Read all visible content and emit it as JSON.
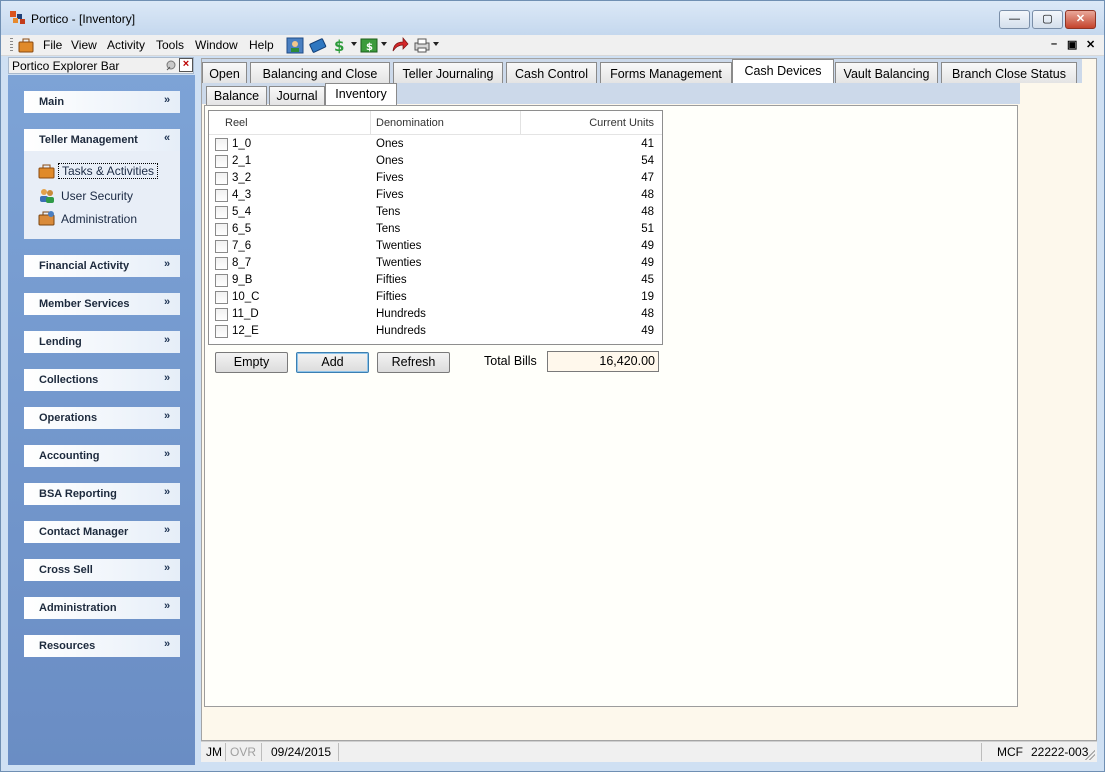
{
  "window": {
    "title": "Portico - [Inventory]"
  },
  "menu": {
    "items": [
      "File",
      "View",
      "Activity",
      "Tools",
      "Window",
      "Help"
    ],
    "mdi_min": "–",
    "mdi_restore": "▣",
    "mdi_close": "✕"
  },
  "explorer": {
    "title": "Portico Explorer Bar",
    "groups": [
      {
        "label": "Main",
        "chevron": "»"
      },
      {
        "label": "Teller Management",
        "chevron": "«",
        "tasks": [
          "Tasks & Activities",
          "User Security",
          "Administration"
        ]
      },
      {
        "label": "Financial Activity",
        "chevron": "»"
      },
      {
        "label": "Member Services",
        "chevron": "»"
      },
      {
        "label": "Lending",
        "chevron": "»"
      },
      {
        "label": "Collections",
        "chevron": "»"
      },
      {
        "label": "Operations",
        "chevron": "»"
      },
      {
        "label": "Accounting",
        "chevron": "»"
      },
      {
        "label": "BSA Reporting",
        "chevron": "»"
      },
      {
        "label": "Contact Manager",
        "chevron": "»"
      },
      {
        "label": "Cross Sell",
        "chevron": "»"
      },
      {
        "label": "Administration",
        "chevron": "»"
      },
      {
        "label": "Resources",
        "chevron": "»"
      }
    ]
  },
  "tabs": {
    "main": [
      "Open",
      "Balancing and Close",
      "Teller Journaling",
      "Cash Control",
      "Forms Management",
      "Cash Devices",
      "Vault Balancing",
      "Branch Close Status"
    ],
    "main_active": "Cash Devices",
    "sub": [
      "Balance",
      "Journal",
      "Inventory"
    ],
    "sub_active": "Inventory"
  },
  "grid": {
    "columns": [
      "Reel",
      "Denomination",
      "Current Units"
    ],
    "rows": [
      {
        "reel": "1_0",
        "denomination": "Ones",
        "units": "41",
        "checked": false
      },
      {
        "reel": "2_1",
        "denomination": "Ones",
        "units": "54",
        "checked": false
      },
      {
        "reel": "3_2",
        "denomination": "Fives",
        "units": "47",
        "checked": false
      },
      {
        "reel": "4_3",
        "denomination": "Fives",
        "units": "48",
        "checked": false
      },
      {
        "reel": "5_4",
        "denomination": "Tens",
        "units": "48",
        "checked": false
      },
      {
        "reel": "6_5",
        "denomination": "Tens",
        "units": "51",
        "checked": false
      },
      {
        "reel": "7_6",
        "denomination": "Twenties",
        "units": "49",
        "checked": false
      },
      {
        "reel": "8_7",
        "denomination": "Twenties",
        "units": "49",
        "checked": false
      },
      {
        "reel": "9_B",
        "denomination": "Fifties",
        "units": "45",
        "checked": false
      },
      {
        "reel": "10_C",
        "denomination": "Fifties",
        "units": "19",
        "checked": false
      },
      {
        "reel": "11_D",
        "denomination": "Hundreds",
        "units": "48",
        "checked": false
      },
      {
        "reel": "12_E",
        "denomination": "Hundreds",
        "units": "49",
        "checked": false
      }
    ]
  },
  "actions": {
    "empty": "Empty",
    "add": "Add",
    "refresh": "Refresh"
  },
  "totals": {
    "label": "Total Bills",
    "value": "16,420.00"
  },
  "status": {
    "user": "JM",
    "ovr": "OVR",
    "date": "09/24/2015",
    "mcf": "MCF",
    "code": "22222-003"
  },
  "colors": {
    "explorer_bg": "#6a8dc4",
    "content_bg": "#fdf8ec",
    "accent": "#3c7fb1"
  }
}
